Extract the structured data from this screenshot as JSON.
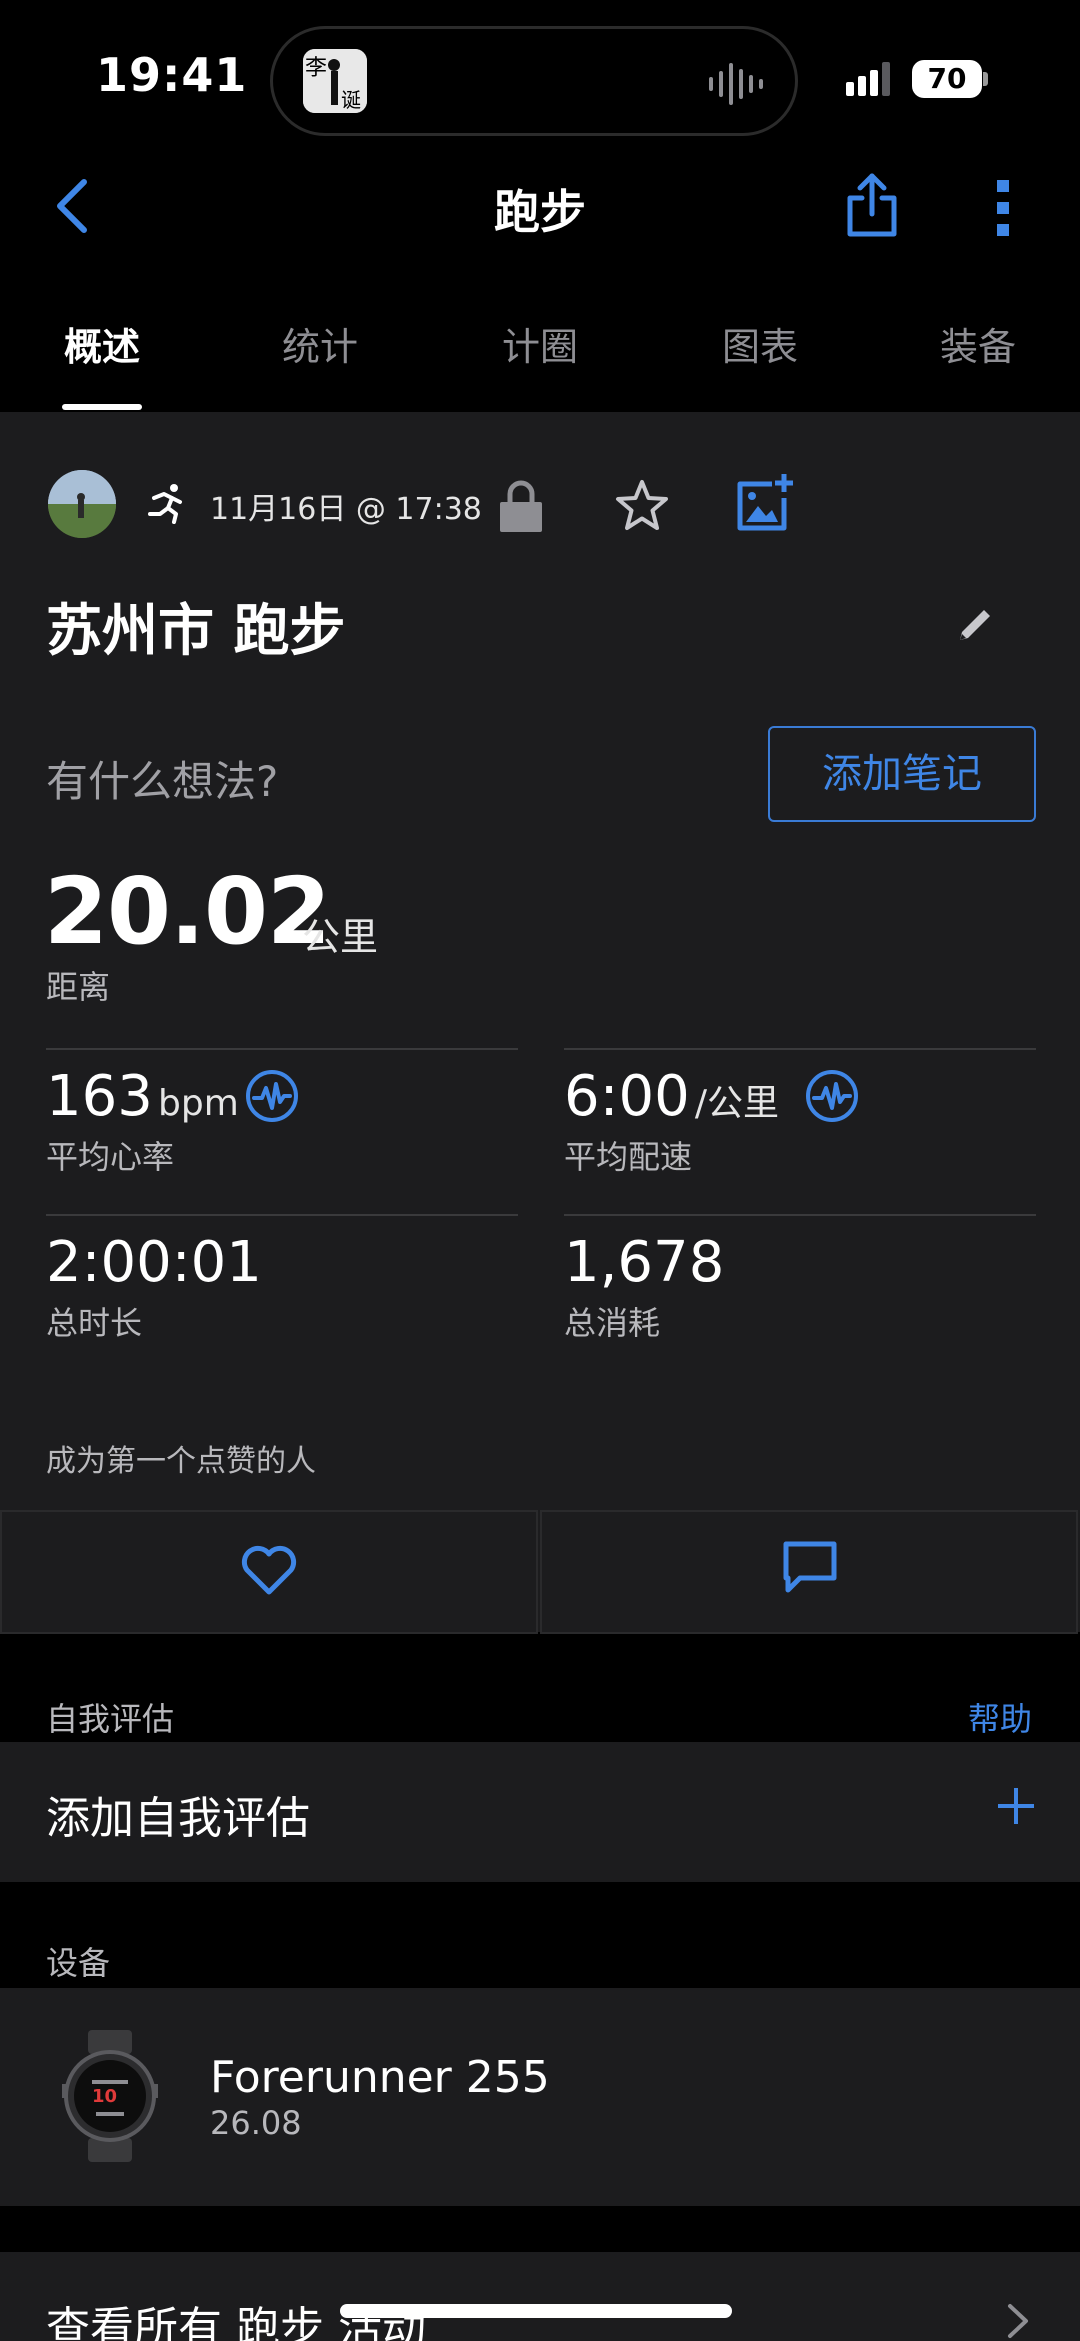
{
  "status_bar": {
    "time": "19:41",
    "island_avatar_text": "李 诞",
    "battery": "70"
  },
  "nav": {
    "title": "跑步",
    "back_icon": "chevron-left-icon",
    "share_icon": "share-icon",
    "more_icon": "more-vertical-icon"
  },
  "tabs": [
    {
      "label": "概述",
      "active": true
    },
    {
      "label": "统计",
      "active": false
    },
    {
      "label": "计圈",
      "active": false
    },
    {
      "label": "图表",
      "active": false
    },
    {
      "label": "装备",
      "active": false
    }
  ],
  "activity": {
    "datetime": "11月16日 @ 17:38",
    "title": "苏州市 跑步",
    "thoughts_placeholder": "有什么想法?",
    "add_note_label": "添加笔记"
  },
  "summary": {
    "distance_value": "20.02",
    "distance_unit": "公里",
    "distance_label": "距离",
    "stats": [
      {
        "value": "163",
        "unit": "bpm",
        "label": "平均心率",
        "icon": "heart-rate-icon"
      },
      {
        "value": "6:00",
        "unit": "/公里",
        "label": "平均配速",
        "icon": "heart-rate-icon"
      },
      {
        "value": "2:00:01",
        "unit": "",
        "label": "总时长"
      },
      {
        "value": "1,678",
        "unit": "",
        "label": "总消耗"
      }
    ]
  },
  "social": {
    "likes_hint": "成为第一个点赞的人"
  },
  "self_eval": {
    "section_label": "自我评估",
    "help_label": "帮助",
    "add_label": "添加自我评估"
  },
  "device": {
    "section_label": "设备",
    "name": "Forerunner 255",
    "version": "26.08"
  },
  "footer": {
    "view_all_label": "查看所有 跑步 活动"
  },
  "colors": {
    "accent": "#3f86e6",
    "panel": "#1c1c1e",
    "background": "#000000"
  }
}
